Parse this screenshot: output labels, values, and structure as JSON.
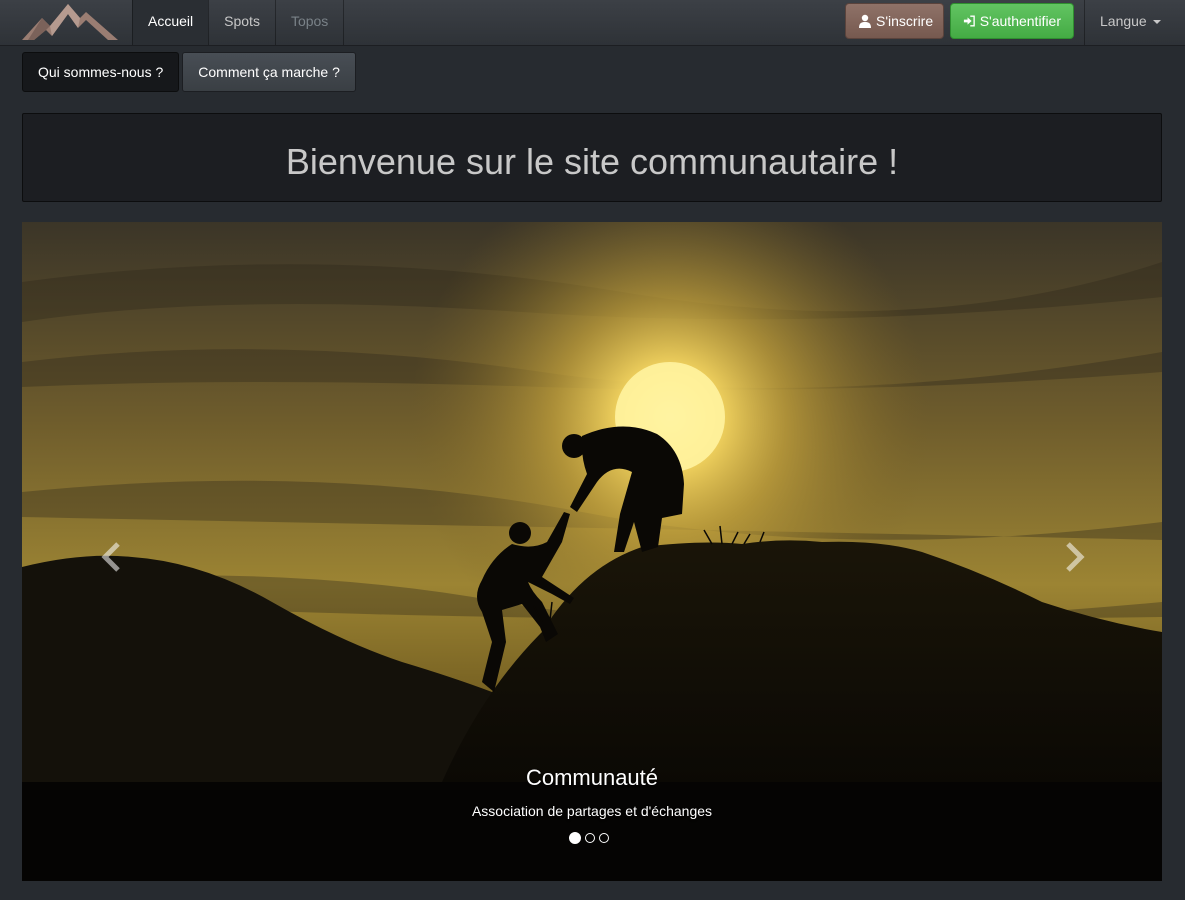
{
  "navbar": {
    "brand_icon": "mountain-logo-icon",
    "links": [
      {
        "label": "Accueil",
        "state": "active"
      },
      {
        "label": "Spots",
        "state": "normal"
      },
      {
        "label": "Topos",
        "state": "disabled"
      }
    ],
    "signup_label": "S'inscrire",
    "signup_icon": "user-icon",
    "login_label": "S'authentifier",
    "login_icon": "sign-in-icon",
    "language_label": "Langue"
  },
  "subnav": {
    "about_label": "Qui sommes-nous ?",
    "how_label": "Comment ça marche ?"
  },
  "welcome": {
    "title": "Bienvenue sur le site communautaire !"
  },
  "carousel": {
    "caption_title": "Communauté",
    "caption_text": "Association de partages et d'échanges",
    "slide_count": 3,
    "active_slide": 1,
    "prev_icon": "chevron-left-icon",
    "next_icon": "chevron-right-icon"
  },
  "colors": {
    "background": "#272b30",
    "signup_button": "#7f6258",
    "login_button": "#4cb84c",
    "sky": "#8a7130",
    "sun": "#fff3a0"
  }
}
